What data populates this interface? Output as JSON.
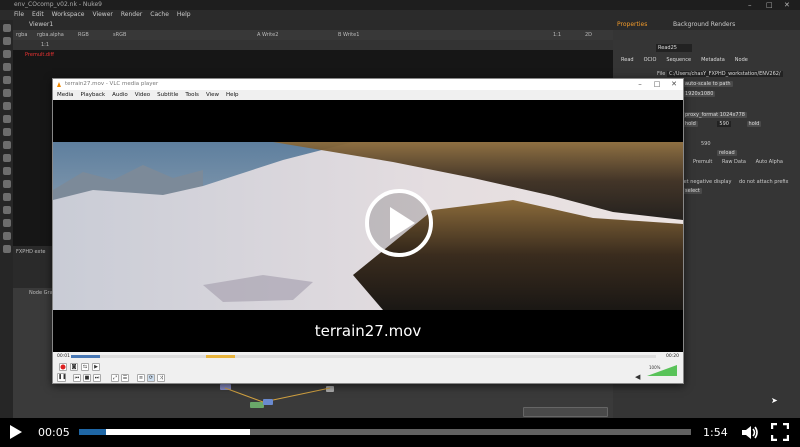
{
  "desktop": {
    "nuke_window_title": "env_COcomp_v02.nk - Nuke9",
    "nuke_menu": [
      "File",
      "Edit",
      "Workspace",
      "Viewer",
      "Render",
      "Cache",
      "Help"
    ],
    "viewer_tab": "Viewer1",
    "viewer_bar": {
      "channels": "rgba",
      "alpha": "rgba.alpha",
      "colorspace": "RGB",
      "lut": "sRGB",
      "input_a": "A  Write2",
      "input_b": "B  Write1",
      "zoom": "1:1",
      "mode": "2D"
    },
    "viewer_label": "Premult.diff",
    "frame_label": "1:1",
    "panel_label": "FXPHD exte",
    "node_graph_label": "Node Graph",
    "properties": {
      "tabs": [
        "Properties",
        "Background Renders"
      ],
      "node_name": "Read25",
      "node_tabs": [
        "Read",
        "OCIO",
        "Sequence",
        "Metadata",
        "Node"
      ],
      "file_label": "File",
      "file_path": "C:/Users/chasY_FXPHD_workstation/ENV262/",
      "fields": {
        "proxy": "auto-scale to path",
        "format": "1920x1080",
        "format2": "proxy_format 1024x778",
        "frame_range": "hold",
        "frame_end": "590",
        "hold2": "hold",
        "reload": "reload",
        "premultiplied": "Premult",
        "raw": "Raw Data",
        "auto": "Auto Alpha",
        "neg": "set negative display",
        "prefix": "do not attach prefix",
        "start": "590",
        "select": "select"
      }
    }
  },
  "vlc": {
    "title": "terrain27.mov - VLC media player",
    "menu": [
      "Media",
      "Playback",
      "Audio",
      "Video",
      "Subtitle",
      "Tools",
      "View",
      "Help"
    ],
    "subtitle": "terrain27.mov",
    "time_elapsed": "00:01",
    "time_total": "00:20",
    "volume": "100%",
    "progress": 0.05,
    "buffered": 0.28
  },
  "player": {
    "current_time": "00:05",
    "total_time": "1:54",
    "progress_fraction": 0.044,
    "buffered_fraction": 0.28,
    "state": "paused"
  },
  "colors": {
    "player_accent": "#1f67a6",
    "vlc_buffer": "#e8b43c",
    "vlc_played": "#4777b4"
  }
}
